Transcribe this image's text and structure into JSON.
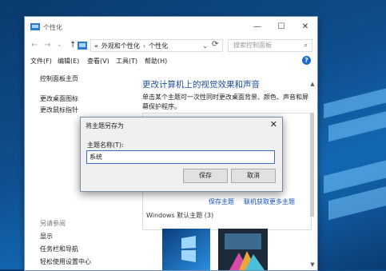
{
  "window": {
    "title": "个性化",
    "controls": {
      "minimize": "—",
      "maximize": "☐",
      "close": "✕"
    },
    "nav": {
      "back": "←",
      "forward": "→",
      "recent": "⌄",
      "up": "↑"
    },
    "address": {
      "root_glyph": "«",
      "crumbs": [
        "外观和个性化",
        "个性化"
      ],
      "separator": "›",
      "dropdown": "⌄"
    },
    "search": {
      "placeholder": "搜索控制面板"
    },
    "menu": [
      "文件(F)",
      "编辑(E)",
      "查看(V)",
      "工具(T)",
      "帮助(H)"
    ],
    "help_glyph": "?"
  },
  "sidebar": {
    "links": [
      "控制面板主页",
      "更改桌面图标",
      "更改鼠标指针"
    ],
    "see_also_heading": "另请参阅",
    "see_also": [
      "显示",
      "任务栏和导航",
      "轻松使用设置中心"
    ]
  },
  "main": {
    "title": "更改计算机上的视觉效果和声音",
    "description": "单击某个主题可一次性同时更改桌面背景、颜色、声音和屏幕保护程序。",
    "save_theme": "保存主题",
    "get_more": "联机获取更多主题",
    "group_title": "Windows 默认主题 (3)"
  },
  "dialog": {
    "title": "将主题另存为",
    "close": "✕",
    "field_label": "主题名称(T):",
    "field_value": "系统",
    "save": "保存",
    "cancel": "取消"
  },
  "colors": {
    "accent": "#1a56c9",
    "title": "#1f4e9a",
    "desktop": "#0f4f8f"
  }
}
